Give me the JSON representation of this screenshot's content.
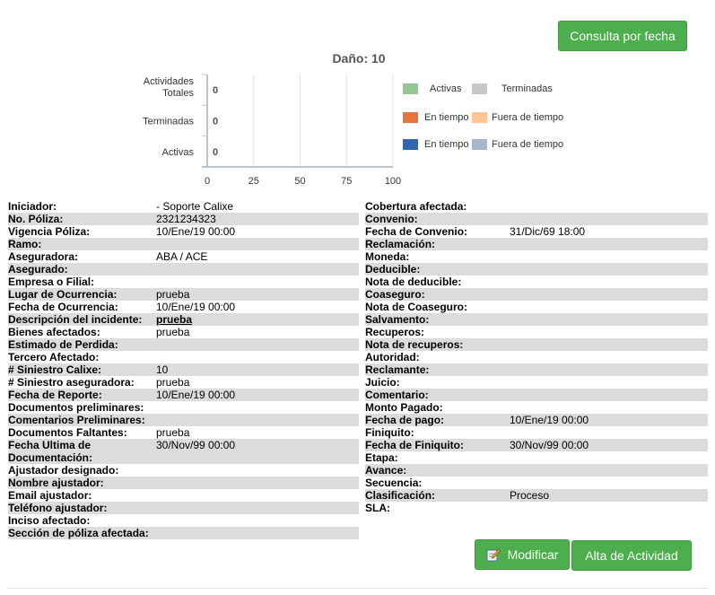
{
  "buttons": {
    "consulta": "Consulta por fecha",
    "modificar": "Modificar",
    "alta": "Alta de Actividad"
  },
  "chart_data": {
    "type": "bar",
    "title": "Daño: 10",
    "orientation": "horizontal",
    "categories": [
      "Actividades Totales",
      "Terminadas",
      "Activas"
    ],
    "values": [
      0,
      0,
      0
    ],
    "xlim": [
      0,
      100
    ],
    "x_ticks": [
      "0",
      "25",
      "50",
      "75",
      "100"
    ],
    "grid": true,
    "legend_position": "right",
    "legend": [
      {
        "name": "Activas",
        "color": "#93c893"
      },
      {
        "name": "Terminadas",
        "color": "#c8c8c8"
      },
      {
        "name": "En tiempo",
        "color": "#e8743b"
      },
      {
        "name": "Fuera de tiempo",
        "color": "#ffc594"
      },
      {
        "name": "En tiempo",
        "color": "#2f67b2"
      },
      {
        "name": "Fuera de tiempo",
        "color": "#a7b6cc"
      }
    ]
  },
  "left_fields": [
    {
      "label": "Iniciador:",
      "value": "- Soporte Calixe"
    },
    {
      "label": "No. Póliza:",
      "value": "2321234323"
    },
    {
      "label": "Vigencia Póliza:",
      "value": "10/Ene/19 00:00"
    },
    {
      "label": "Ramo:",
      "value": ""
    },
    {
      "label": "Aseguradora:",
      "value": "ABA / ACE"
    },
    {
      "label": "Asegurado:",
      "value": ""
    },
    {
      "label": "Empresa o Filial:",
      "value": ""
    },
    {
      "label": "Lugar de Ocurrencia:",
      "value": "prueba"
    },
    {
      "label": "Fecha de Ocurrencia:",
      "value": "10/Ene/19 00:00"
    },
    {
      "label": "Descripción del incidente:",
      "value": "prueba"
    },
    {
      "label": "Bienes afectados:",
      "value": "prueba"
    },
    {
      "label": "Estimado de Perdida:",
      "value": ""
    },
    {
      "label": "Tercero Afectado:",
      "value": ""
    },
    {
      "label": "# Siniestro Calixe:",
      "value": "10"
    },
    {
      "label": "# Siniestro aseguradora:",
      "value": "prueba"
    },
    {
      "label": "Fecha de Reporte:",
      "value": "10/Ene/19 00:00"
    },
    {
      "label": "Documentos preliminares:",
      "value": ""
    },
    {
      "label": "Comentarios Preliminares:",
      "value": ""
    },
    {
      "label": "Documentos Faltantes:",
      "value": "prueba"
    },
    {
      "label": "Fecha Ultima de Documentación:",
      "value": "30/Nov/99 00:00"
    },
    {
      "label": "Ajustador designado:",
      "value": ""
    },
    {
      "label": "Nombre ajustador:",
      "value": ""
    },
    {
      "label": "Email ajustador:",
      "value": ""
    },
    {
      "label": "Teléfono ajustador:",
      "value": ""
    },
    {
      "label": "Inciso afectado:",
      "value": ""
    },
    {
      "label": "Sección de póliza afectada:",
      "value": ""
    }
  ],
  "right_fields": [
    {
      "label": "Cobertura afectada:",
      "value": ""
    },
    {
      "label": "Convenio:",
      "value": ""
    },
    {
      "label": "Fecha de Convenio:",
      "value": "31/Dic/69 18:00"
    },
    {
      "label": "Reclamación:",
      "value": ""
    },
    {
      "label": "Moneda:",
      "value": ""
    },
    {
      "label": "Deducible:",
      "value": ""
    },
    {
      "label": "Nota de deducible:",
      "value": ""
    },
    {
      "label": "Coaseguro:",
      "value": ""
    },
    {
      "label": "Nota de Coaseguro:",
      "value": ""
    },
    {
      "label": "Salvamento:",
      "value": ""
    },
    {
      "label": "Recuperos:",
      "value": ""
    },
    {
      "label": "Nota de recuperos:",
      "value": ""
    },
    {
      "label": "Autoridad:",
      "value": ""
    },
    {
      "label": "Reclamante:",
      "value": ""
    },
    {
      "label": "Juicio:",
      "value": ""
    },
    {
      "label": "Comentario:",
      "value": ""
    },
    {
      "label": "Monto Pagado:",
      "value": ""
    },
    {
      "label": "Fecha de pago:",
      "value": "10/Ene/19 00:00"
    },
    {
      "label": "Finiquito:",
      "value": ""
    },
    {
      "label": "Fecha de Finiquito:",
      "value": "30/Nov/99 00:00"
    },
    {
      "label": "Etapa:",
      "value": ""
    },
    {
      "label": "Avance:",
      "value": ""
    },
    {
      "label": "Secuencia:",
      "value": ""
    },
    {
      "label": "Clasificación:",
      "value": "Proceso"
    },
    {
      "label": "SLA:",
      "value": ""
    }
  ]
}
